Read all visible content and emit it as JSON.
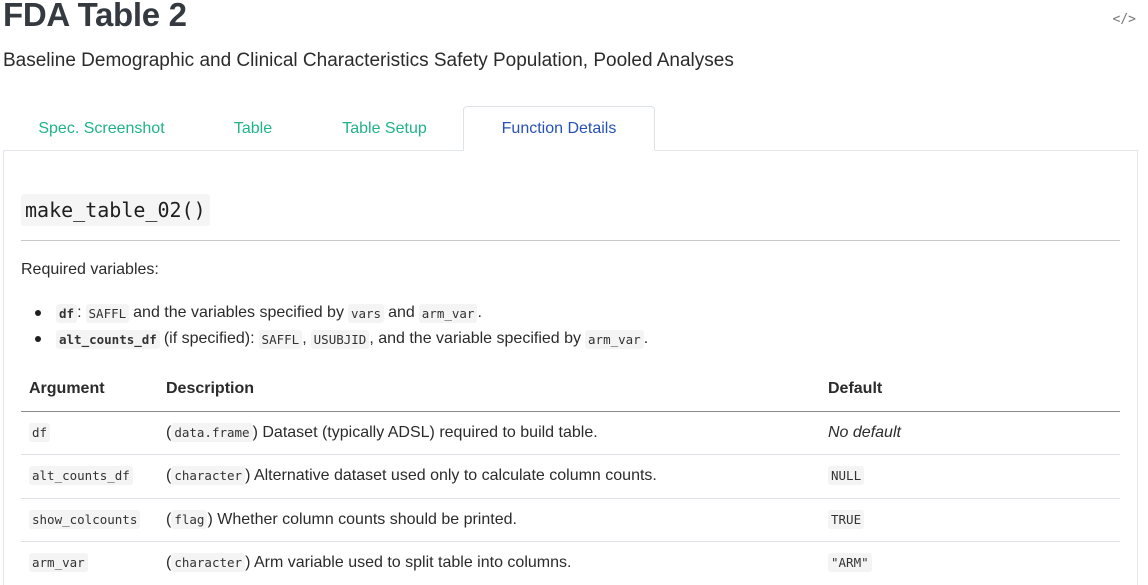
{
  "header": {
    "title": "FDA Table 2",
    "subtitle": "Baseline Demographic and Clinical Characteristics Safety Population, Pooled Analyses",
    "code_toggle": "</>"
  },
  "tabs": [
    {
      "label": "Spec. Screenshot",
      "active": false
    },
    {
      "label": "Table",
      "active": false
    },
    {
      "label": "Table Setup",
      "active": false
    },
    {
      "label": "Function Details",
      "active": true
    }
  ],
  "function": {
    "name": "make_table_02()",
    "required_label": "Required variables:",
    "bullets": [
      {
        "code1": "df",
        "sep1": ":",
        "code2": "SAFFL",
        "text1": "and the variables specified by",
        "code3": "vars",
        "text2": "and",
        "code4": "arm_var",
        "end": "."
      },
      {
        "code1": "alt_counts_df",
        "text1": "(if specified):",
        "code2": "SAFFL",
        "sep1": ",",
        "code3": "USUBJID",
        "text2": ", and the variable specified by",
        "code4": "arm_var",
        "end": "."
      }
    ]
  },
  "args_table": {
    "headers": [
      "Argument",
      "Description",
      "Default"
    ],
    "rows": [
      {
        "arg": "df",
        "type": "data.frame",
        "desc": "Dataset (typically ADSL) required to build table.",
        "default": "No default",
        "default_style": "italic"
      },
      {
        "arg": "alt_counts_df",
        "type": "character",
        "desc": "Alternative dataset used only to calculate column counts.",
        "default": "NULL",
        "default_style": "code"
      },
      {
        "arg": "show_colcounts",
        "type": "flag",
        "desc": "Whether column counts should be printed.",
        "default": "TRUE",
        "default_style": "code"
      },
      {
        "arg": "arm_var",
        "type": "character",
        "desc": "Arm variable used to split table into columns.",
        "default": "\"ARM\"",
        "default_style": "code"
      }
    ]
  },
  "colors": {
    "tab_link": "#20b38a",
    "tab_active": "#2851b8",
    "title": "#343a40"
  }
}
